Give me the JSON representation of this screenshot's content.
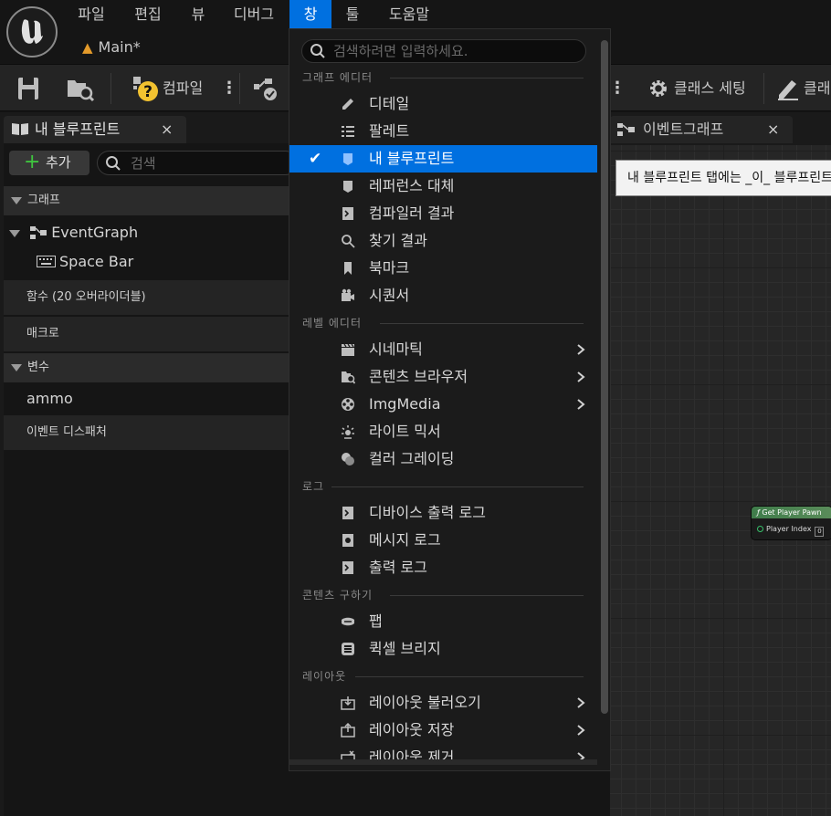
{
  "menubar": {
    "items": [
      "파일",
      "편집",
      "뷰",
      "디버그",
      "창",
      "툴",
      "도움말"
    ],
    "active": "창"
  },
  "document_tab": {
    "label": "Main*"
  },
  "toolbar": {
    "compile_label": "컴파일",
    "class_settings_label": "클래스 세팅",
    "class_defaults_partial": "클래"
  },
  "left_panel": {
    "tab_label": "내 블루프린트",
    "close": "×",
    "add_label": "추가",
    "search_placeholder": "검색",
    "sections": {
      "graphs": "그래프",
      "functions": "함수 (20 오버라이더블)",
      "macros": "매크로",
      "variables": "변수",
      "dispatchers": "이벤트 디스패처"
    },
    "tree": {
      "event_graph": "EventGraph",
      "space_bar": "Space Bar",
      "ammo": "ammo"
    }
  },
  "graph": {
    "tab_label": "이벤트그래프",
    "close": "×",
    "tooltip": "내 블루프린트 탭에는 _이_ 블루프린트의 ",
    "node": {
      "title": "Get Player Pawn",
      "pin_label": "Player Index",
      "pin_value": "0"
    }
  },
  "dropdown": {
    "search_placeholder": "검색하려면 입력하세요.",
    "sections": {
      "graph_editor": "그래프 에디터",
      "level_editor": "레벨 에디터",
      "log": "로그",
      "get_content": "콘텐츠 구하기",
      "layout": "레이아웃"
    },
    "graph_editor_items": [
      {
        "label": "디테일",
        "icon": "pencil-icon"
      },
      {
        "label": "팔레트",
        "icon": "list-icon"
      },
      {
        "label": "내 블루프린트",
        "icon": "blueprint-book-icon",
        "checked": true
      },
      {
        "label": "레퍼런스 대체",
        "icon": "blueprint-book-icon"
      },
      {
        "label": "컴파일러 결과",
        "icon": "log-icon"
      },
      {
        "label": "찾기 결과",
        "icon": "search-icon"
      },
      {
        "label": "북마크",
        "icon": "bookmark-icon"
      },
      {
        "label": "시퀀서",
        "icon": "camera-icon"
      }
    ],
    "level_editor_items": [
      {
        "label": "시네마틱",
        "icon": "clapperboard-icon",
        "submenu": true
      },
      {
        "label": "콘텐츠 브라우저",
        "icon": "folder-search-icon",
        "submenu": true
      },
      {
        "label": "ImgMedia",
        "icon": "film-reel-icon",
        "submenu": true
      },
      {
        "label": "라이트 믹서",
        "icon": "light-icon"
      },
      {
        "label": "컬러 그레이딩",
        "icon": "color-wheel-icon"
      }
    ],
    "log_items": [
      {
        "label": "디바이스 출력 로그",
        "icon": "log-icon"
      },
      {
        "label": "메시지 로그",
        "icon": "message-log-icon"
      },
      {
        "label": "출력 로그",
        "icon": "log-icon"
      }
    ],
    "content_items": [
      {
        "label": "팹",
        "icon": "fab-icon"
      },
      {
        "label": "퀵셀 브리지",
        "icon": "bridge-icon"
      }
    ],
    "layout_items": [
      {
        "label": "레이아웃 불러오기",
        "icon": "layout-load-icon",
        "submenu": true
      },
      {
        "label": "레이아웃 저장",
        "icon": "layout-save-icon",
        "submenu": true
      },
      {
        "label": "레이아웃 제거",
        "icon": "layout-remove-icon",
        "submenu": true
      }
    ]
  }
}
